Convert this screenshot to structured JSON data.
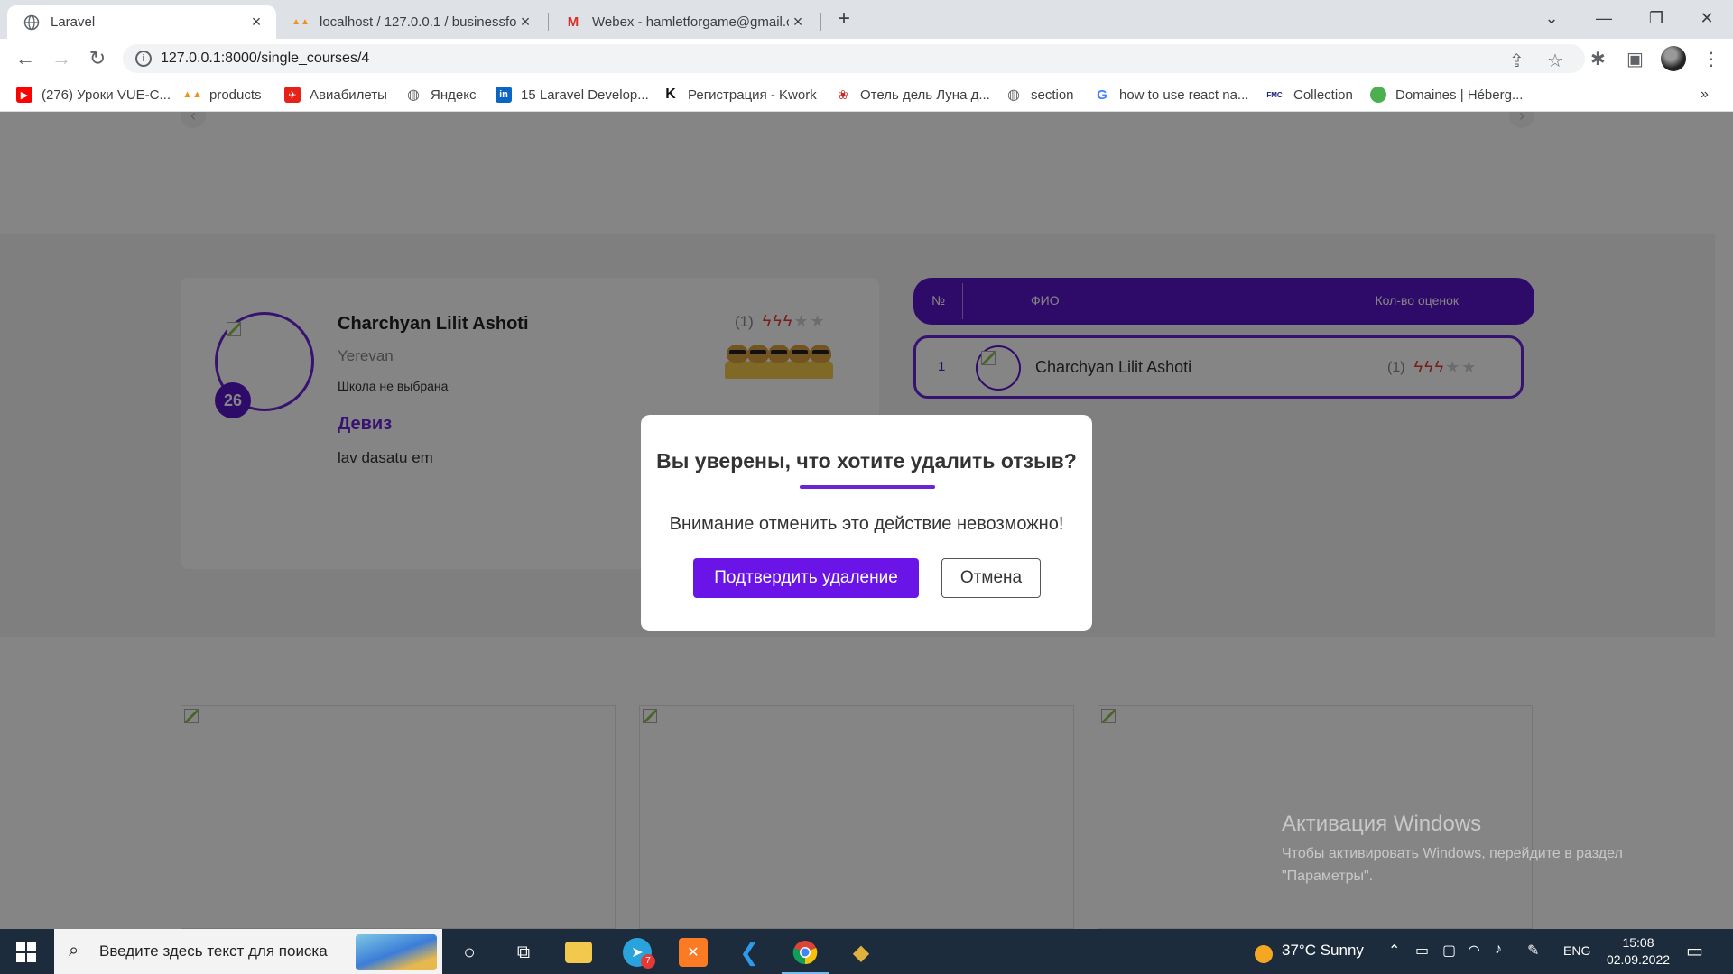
{
  "browser": {
    "tabs": [
      {
        "title": "Laravel",
        "icon": "globe-icon"
      },
      {
        "title": "localhost / 127.0.0.1 / businessfo",
        "icon": "phpmyadmin-icon"
      },
      {
        "title": "Webex - hamletforgame@gmail.c",
        "icon": "gmail-icon"
      }
    ],
    "url": "127.0.0.1:8000/single_courses/4",
    "bookmarks": [
      {
        "label": "(276) Уроки VUE-С...",
        "icon": "youtube-icon",
        "color": "#ff0000"
      },
      {
        "label": "products",
        "icon": "phpmyadmin-icon",
        "color": "#f29111"
      },
      {
        "label": "Авиабилеты",
        "icon": "ticket-icon",
        "color": "#e62117"
      },
      {
        "label": "Яндекс",
        "icon": "globe-icon",
        "color": "#5f6368"
      },
      {
        "label": "15 Laravel Develop...",
        "icon": "linkedin-icon",
        "color": "#0a66c2"
      },
      {
        "label": "Регистрация - Kwork",
        "icon": "kwork-icon",
        "color": "#111111"
      },
      {
        "label": "Отель дель Луна д...",
        "icon": "hotel-icon",
        "color": "#c62828"
      },
      {
        "label": "section",
        "icon": "globe-icon",
        "color": "#5f6368"
      },
      {
        "label": "how to use react na...",
        "icon": "google-icon",
        "color": "#4285f4"
      },
      {
        "label": "Collection",
        "icon": "fmc-icon",
        "color": "#1a237e"
      },
      {
        "label": "Domaines | Héberg...",
        "icon": "green-dot-icon",
        "color": "#4caf50"
      }
    ]
  },
  "profile": {
    "age": "26",
    "name": "Charchyan Lilit Ashoti",
    "city": "Yerevan",
    "school": "Школа не выбрана",
    "motto_title": "Девиз",
    "motto": "lav dasatu em",
    "rating_count": "(1)",
    "rating": 3,
    "rating_max": 5
  },
  "ranking_table": {
    "headers": {
      "num": "№",
      "name": "ФИО",
      "ratings": "Кол-во оценок"
    },
    "rows": [
      {
        "num": "1",
        "name": "Charchyan Lilit Ashoti",
        "rating_count": "(1)",
        "rating": 3,
        "rating_max": 5
      }
    ]
  },
  "modal": {
    "title": "Вы уверены, что хотите удалить отзыв?",
    "warning": "Внимание отменить это действие невозможно!",
    "confirm_label": "Подтвердить удаление",
    "cancel_label": "Отмена",
    "accent_color": "#6a14e8"
  },
  "watermark": {
    "title": "Активация Windows",
    "text": "Чтобы активировать Windows, перейдите в раздел \"Параметры\"."
  },
  "taskbar": {
    "search_placeholder": "Введите здесь текст для поиска",
    "weather": "37°C  Sunny",
    "language": "ENG",
    "time": "15:08",
    "date": "02.09.2022",
    "telegram_badge": "7"
  }
}
